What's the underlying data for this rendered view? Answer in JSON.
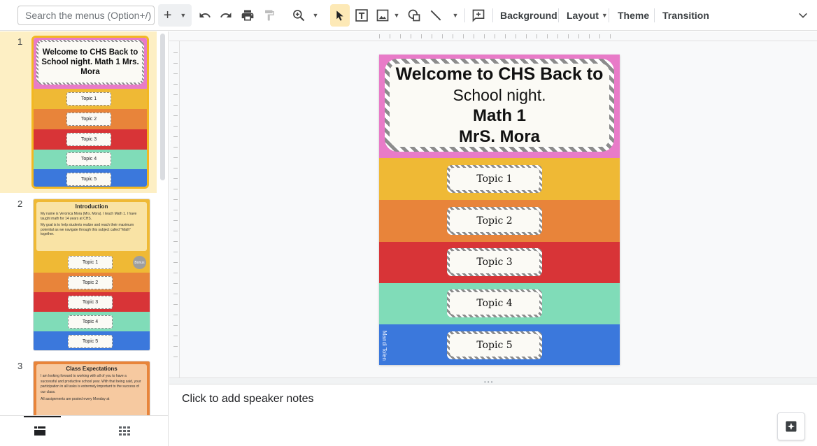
{
  "toolbar": {
    "search_placeholder": "Search the menus (Option+/)",
    "background_label": "Background",
    "layout_label": "Layout",
    "theme_label": "Theme",
    "transition_label": "Transition"
  },
  "filmstrip": {
    "slides": [
      {
        "number": "1",
        "title": "Welcome to CHS Back to School night. Math 1 Mrs. Mora",
        "topics": [
          "Topic 1",
          "Topic 2",
          "Topic 3",
          "Topic 4",
          "Topic 5"
        ]
      },
      {
        "number": "2",
        "title": "Introduction",
        "body1": "My name is Veronica Mora (Mrs. Mora). I teach Math 1. I have taught math for 14 years at CHS.",
        "body2": "My goal is to help students realize and reach their maximum potential as we navigate through this subject called \"Math\" together.",
        "badge": "Bonus",
        "topics": [
          "Topic 1",
          "Topic 2",
          "Topic 3",
          "Topic 4",
          "Topic 5"
        ]
      },
      {
        "number": "3",
        "title": "Class Expectations",
        "body1": "I am looking forward to working with all of you to have a successful and productive school year. With that being said, your participation in all tasks is extremely important to the success of our class.",
        "body2": "All assignments are posted every Monday at"
      }
    ]
  },
  "slide": {
    "title_line1": "Welcome to CHS Back to",
    "title_line2": "School night.",
    "title_line3": "Math 1",
    "title_line4": "MrS. Mora",
    "topics": [
      "Topic 1",
      "Topic 2",
      "Topic 3",
      "Topic 4",
      "Topic 5"
    ],
    "band_colors": [
      "#efb935",
      "#e8843a",
      "#d83437",
      "#80dcb8",
      "#3b78dc"
    ],
    "header_color": "#e87bc8",
    "watermark": "Mandi Tolen"
  },
  "notes": {
    "placeholder": "Click to add speaker notes"
  },
  "colors": {
    "accent_selection": "#fde9b6",
    "active_thumb_border": "#f3b821"
  }
}
